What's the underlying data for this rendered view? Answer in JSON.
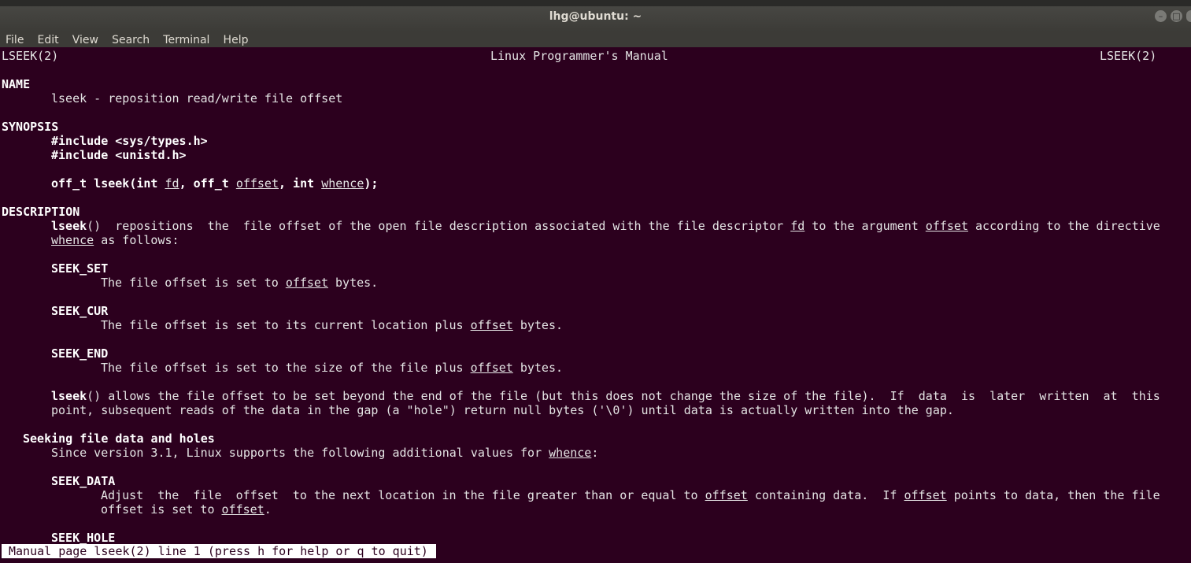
{
  "window": {
    "title": "lhg@ubuntu: ~"
  },
  "menu": [
    "File",
    "Edit",
    "View",
    "Search",
    "Terminal",
    "Help"
  ],
  "man": {
    "header_left": "LSEEK(2)",
    "header_center": "Linux Programmer's Manual",
    "header_right": "LSEEK(2)",
    "name_heading": "NAME",
    "name_line": "lseek - reposition read/write file offset",
    "synopsis_heading": "SYNOPSIS",
    "include1": "#include <sys/types.h>",
    "include2": "#include <unistd.h>",
    "proto": {
      "p1": "off_t lseek(int ",
      "fd": "fd",
      "p2": ", off_t ",
      "offset": "offset",
      "p3": ", int ",
      "whence": "whence",
      "p4": ");"
    },
    "description_heading": "DESCRIPTION",
    "desc1": {
      "b": "lseek",
      "t1": "()  repositions  the  file offset of the open file description associated with the file descriptor ",
      "fd": "fd",
      "t2": " to the argument ",
      "offset": "offset",
      "t3": " according to the directive"
    },
    "desc2": {
      "whence": "whence",
      "t": " as follows:"
    },
    "seek_set": "SEEK_SET",
    "seek_set_desc": {
      "t1": "The file offset is set to ",
      "u": "offset",
      "t2": " bytes."
    },
    "seek_cur": "SEEK_CUR",
    "seek_cur_desc": {
      "t1": "The file offset is set to its current location plus ",
      "u": "offset",
      "t2": " bytes."
    },
    "seek_end": "SEEK_END",
    "seek_end_desc": {
      "t1": "The file offset is set to the size of the file plus ",
      "u": "offset",
      "t2": " bytes."
    },
    "beyond1": {
      "b": "lseek",
      "t": "() allows the file offset to be set beyond the end of the file (but this does not change the size of the file).  If  data  is  later  written  at  this"
    },
    "beyond2": "point, subsequent reads of the data in the gap (a \"hole\") return null bytes ('\\0') until data is actually written into the gap.",
    "holes_heading": "Seeking file data and holes",
    "holes_line": {
      "t": "Since version 3.1, Linux supports the following additional values for ",
      "u": "whence",
      "t2": ":"
    },
    "seek_data": "SEEK_DATA",
    "seek_data_desc1": {
      "t1": "Adjust  the  file  offset  to the next location in the file greater than or equal to ",
      "u1": "offset",
      "t2": " containing data.  If ",
      "u2": "offset",
      "t3": " points to data, then the file"
    },
    "seek_data_desc2": {
      "t1": "offset is set to ",
      "u": "offset",
      "t2": "."
    },
    "seek_hole": "SEEK_HOLE"
  },
  "status": "Manual page lseek(2) line 1 (press h for help or q to quit)"
}
